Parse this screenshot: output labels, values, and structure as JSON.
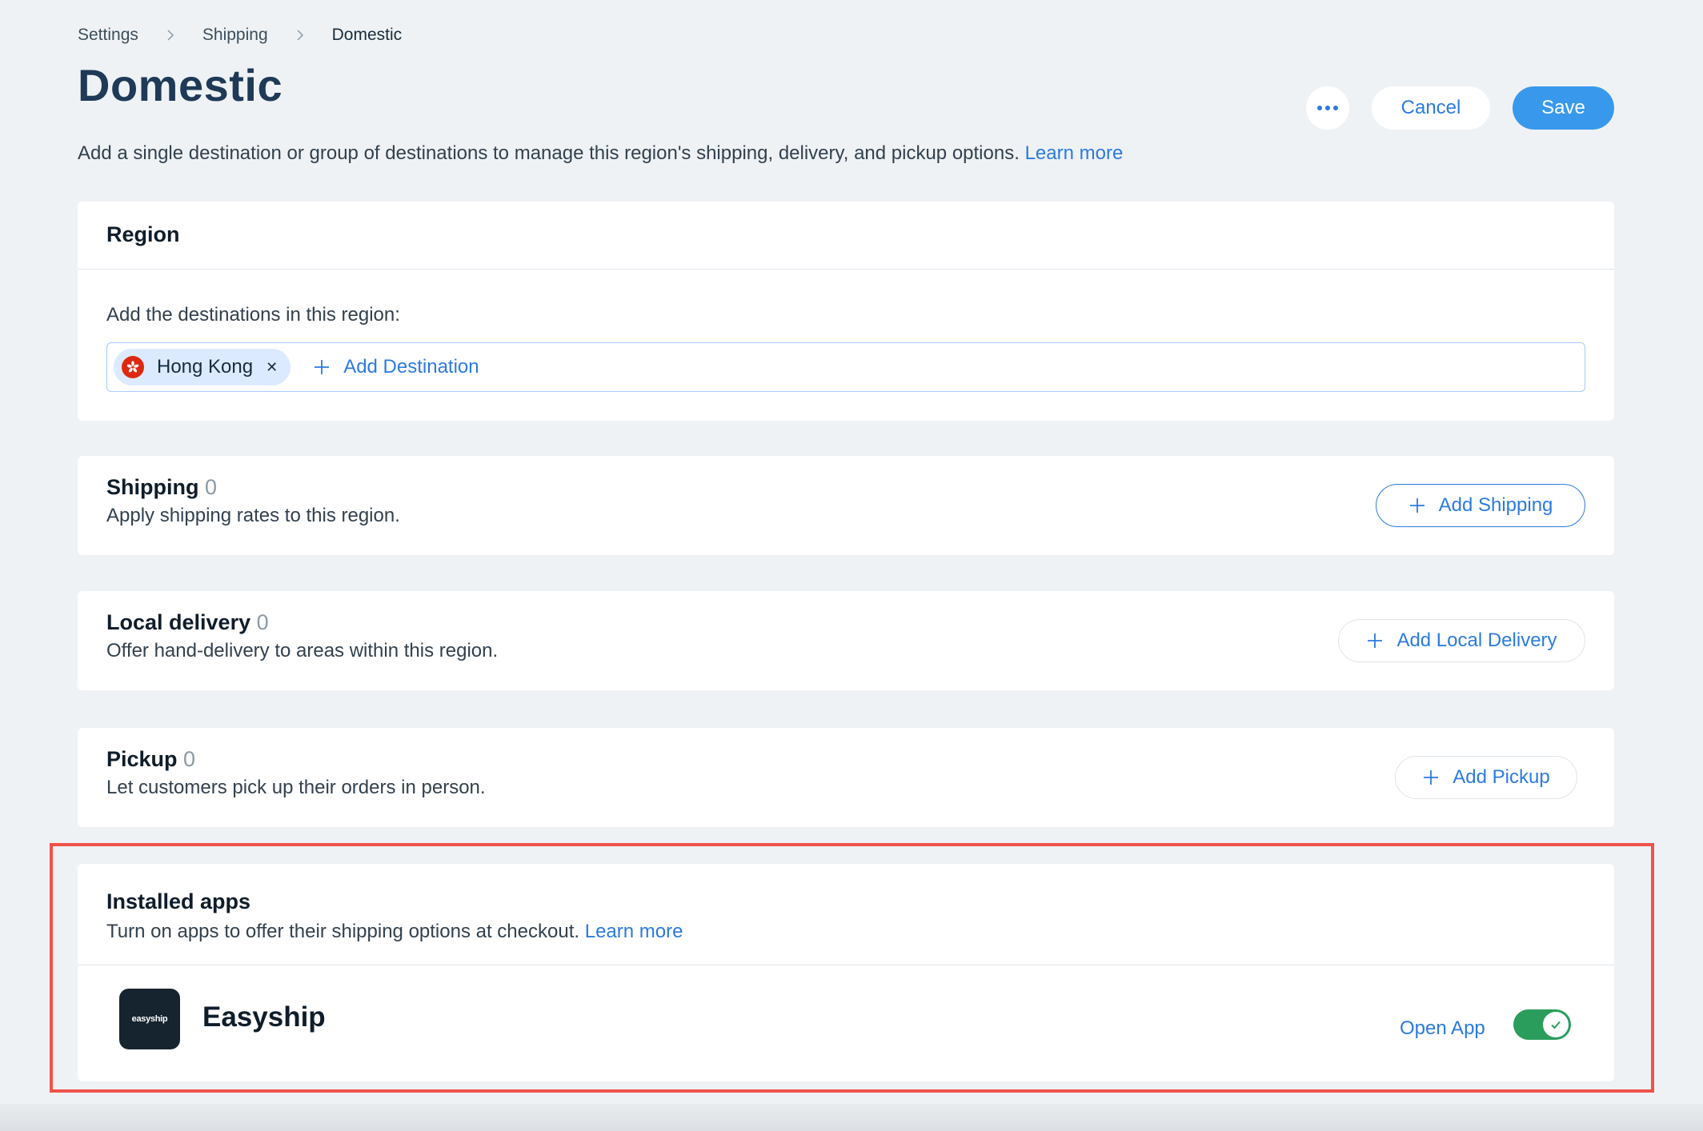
{
  "breadcrumb": {
    "items": [
      "Settings",
      "Shipping",
      "Domestic"
    ]
  },
  "page": {
    "title": "Domestic",
    "description": "Add a single destination or group of destinations to manage this region's shipping, delivery, and pickup options.",
    "learn_more": "Learn more"
  },
  "header_actions": {
    "more_icon": "more-horizontal-icon",
    "cancel_label": "Cancel",
    "save_label": "Save"
  },
  "region": {
    "title": "Region",
    "label": "Add the destinations in this region:",
    "destinations": [
      {
        "name": "Hong Kong",
        "flag_icon": "hong-kong-flag-icon"
      }
    ],
    "add_destination_label": "Add Destination"
  },
  "shipping": {
    "title": "Shipping",
    "count": "0",
    "description": "Apply shipping rates to this region.",
    "button_label": "Add Shipping"
  },
  "local_delivery": {
    "title": "Local delivery",
    "count": "0",
    "description": "Offer hand-delivery to areas within this region.",
    "button_label": "Add Local Delivery"
  },
  "pickup": {
    "title": "Pickup",
    "count": "0",
    "description": "Let customers pick up their orders in person.",
    "button_label": "Add Pickup"
  },
  "installed_apps": {
    "title": "Installed apps",
    "description": "Turn on apps to offer their shipping options at checkout.",
    "learn_more": "Learn more",
    "apps": [
      {
        "logo_text": "easyship",
        "name": "Easyship",
        "open_label": "Open App",
        "enabled": true
      }
    ]
  },
  "colors": {
    "accent": "#2b7be0",
    "save_button": "#3899ec",
    "toggle_on": "#2a9d5c",
    "highlight_border": "#f0534a",
    "background": "#eff2f5"
  }
}
